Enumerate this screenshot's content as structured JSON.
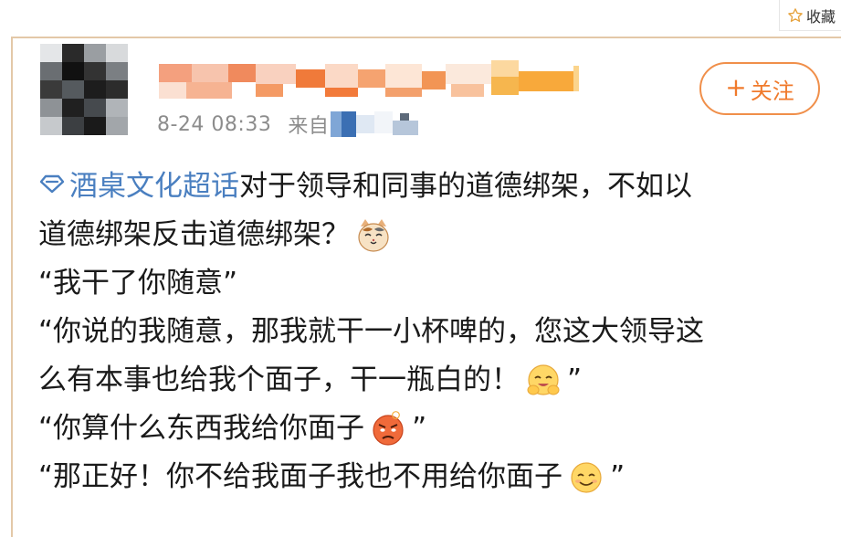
{
  "header": {
    "collect_label": "收藏",
    "collect_icon": "star-outline-icon"
  },
  "post": {
    "timestamp": "8-24 08:33",
    "source_prefix": "来自",
    "follow_label": "关注",
    "follow_icon": "plus-icon",
    "topic_icon": "supertopic-diamond-icon",
    "topic": "酒桌文化超话",
    "lines": {
      "l1": "对于领导和同事的道德绑架，不如以",
      "l2": "道德绑架反击道德绑架？",
      "l3": "“我干了你随意”",
      "l4": "“你说的我随意，那我就干一小杯啤的，您这大领导这",
      "l5": "么有本事也给我个面子，干一瓶白的！",
      "l5_end": "”",
      "l6": "“你算什么东西我给你面子",
      "l6_end": "”",
      "l7": "“那正好！你不给我面子我也不用给你面子",
      "l7_end": "”"
    },
    "emojis": [
      "cat-face-emoji",
      "hugging-face-emoji",
      "angry-face-emoji",
      "smiling-face-emoji"
    ]
  },
  "colors": {
    "accent": "#f07a2c",
    "link": "#4a7fc0",
    "card_border": "#e3c8a8",
    "meta_text": "#8c8c8c"
  }
}
